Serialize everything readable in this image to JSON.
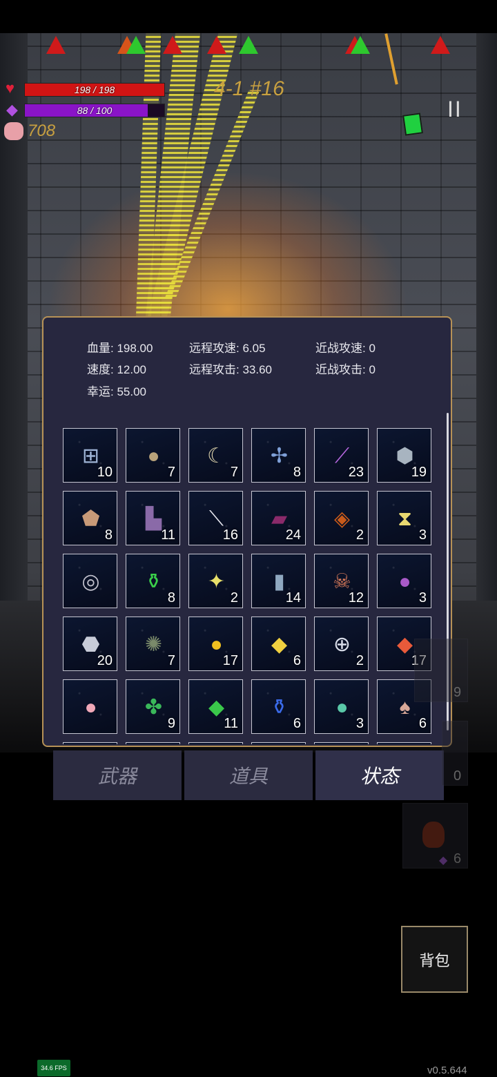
{
  "hud": {
    "hp_text": "198 / 198",
    "hp_fraction": 1.0,
    "mp_text": "88 / 100",
    "mp_fraction": 0.88,
    "coins": "708",
    "stage": "4-1 #16",
    "pause_symbol": "II",
    "hp_color": "#d11414",
    "mp_color": "#8a14c8",
    "stage_color": "#c8a040",
    "coin_color": "#c8a040"
  },
  "stats": {
    "hp_label": "血量:",
    "hp_value": "198.00",
    "speed_label": "速度:",
    "speed_value": "12.00",
    "luck_label": "幸运:",
    "luck_value": "55.00",
    "ranged_speed_label": "远程攻速:",
    "ranged_speed_value": "6.05",
    "ranged_attack_label": "远程攻击:",
    "ranged_attack_value": "33.60",
    "melee_speed_label": "近战攻速:",
    "melee_speed_value": "0",
    "melee_attack_label": "近战攻击:",
    "melee_attack_value": "0"
  },
  "items": [
    {
      "icon": "medkit-icon",
      "glyph": "⊞",
      "color": "#9fb4d6",
      "count": "10"
    },
    {
      "icon": "egg-icon",
      "glyph": "●",
      "color": "#b8a27a",
      "count": "7"
    },
    {
      "icon": "horn-icon",
      "glyph": "☾",
      "color": "#d9cfa8",
      "count": "7"
    },
    {
      "icon": "dragonfly-icon",
      "glyph": "✢",
      "color": "#7fa0d8",
      "count": "8"
    },
    {
      "icon": "vial-icon",
      "glyph": "⟋",
      "color": "#b868e0",
      "count": "23"
    },
    {
      "icon": "stone-icon",
      "glyph": "⬢",
      "color": "#a8b4c0",
      "count": "19"
    },
    {
      "icon": "sack-icon",
      "glyph": "⬟",
      "color": "#c89a78",
      "count": "8"
    },
    {
      "icon": "boots-icon",
      "glyph": "▙",
      "color": "#8a6aa8",
      "count": "11"
    },
    {
      "icon": "feather-icon",
      "glyph": "⟍",
      "color": "#e8e8f0",
      "count": "16"
    },
    {
      "icon": "spellbook-purple-icon",
      "glyph": "▰",
      "color": "#8a2a6a",
      "count": "24"
    },
    {
      "icon": "spellbook-red-icon",
      "glyph": "◈",
      "color": "#c85a1a",
      "count": "2"
    },
    {
      "icon": "hourglass-card-icon",
      "glyph": "⧗",
      "color": "#e8d870",
      "count": "3"
    },
    {
      "icon": "ring-icon",
      "glyph": "◎",
      "color": "#c0c0cc",
      "count": ""
    },
    {
      "icon": "green-potion-icon",
      "glyph": "⚱",
      "color": "#3ad04a",
      "count": "8"
    },
    {
      "icon": "star-crystal-icon",
      "glyph": "✦",
      "color": "#e8e06a",
      "count": "2"
    },
    {
      "icon": "bottle-icon",
      "glyph": "▮",
      "color": "#8fa8c0",
      "count": "14"
    },
    {
      "icon": "skull-feather-icon",
      "glyph": "☠",
      "color": "#d87a5a",
      "count": "12"
    },
    {
      "icon": "slime-icon",
      "glyph": "●",
      "color": "#a85ac8",
      "count": "3"
    },
    {
      "icon": "ore-icon",
      "glyph": "⬣",
      "color": "#c8ccd8",
      "count": "20"
    },
    {
      "icon": "tentacle-icon",
      "glyph": "✺",
      "color": "#7a8a6a",
      "count": "7"
    },
    {
      "icon": "gold-coin-icon",
      "glyph": "●",
      "color": "#f0c020",
      "count": "17"
    },
    {
      "icon": "yellow-gem-icon",
      "glyph": "◆",
      "color": "#f0d040",
      "count": "6"
    },
    {
      "icon": "shield-ring-icon",
      "glyph": "⊕",
      "color": "#d8dce8",
      "count": "2"
    },
    {
      "icon": "red-crystal-icon",
      "glyph": "◆",
      "color": "#e85a3a",
      "count": "17"
    },
    {
      "icon": "piggy-bank-icon",
      "glyph": "●",
      "color": "#f0a8b8",
      "count": ""
    },
    {
      "icon": "clover-icon",
      "glyph": "✤",
      "color": "#3ab85a",
      "count": "9"
    },
    {
      "icon": "green-crystal-icon",
      "glyph": "◆",
      "color": "#3ac84a",
      "count": "11"
    },
    {
      "icon": "blue-potion-icon",
      "glyph": "⚱",
      "color": "#3a6ae8",
      "count": "6"
    },
    {
      "icon": "rainbow-orb-icon",
      "glyph": "●",
      "color": "#5ac8a8",
      "count": "3"
    },
    {
      "icon": "mushroom-icon",
      "glyph": "♠",
      "color": "#d8a898",
      "count": "6"
    }
  ],
  "tabs": {
    "weapons": "武器",
    "items": "道具",
    "status": "状态"
  },
  "side_counts": [
    "9",
    "0",
    "6"
  ],
  "bag_label": "背包",
  "fps": "34.6 FPS",
  "version": "v0.5.644"
}
